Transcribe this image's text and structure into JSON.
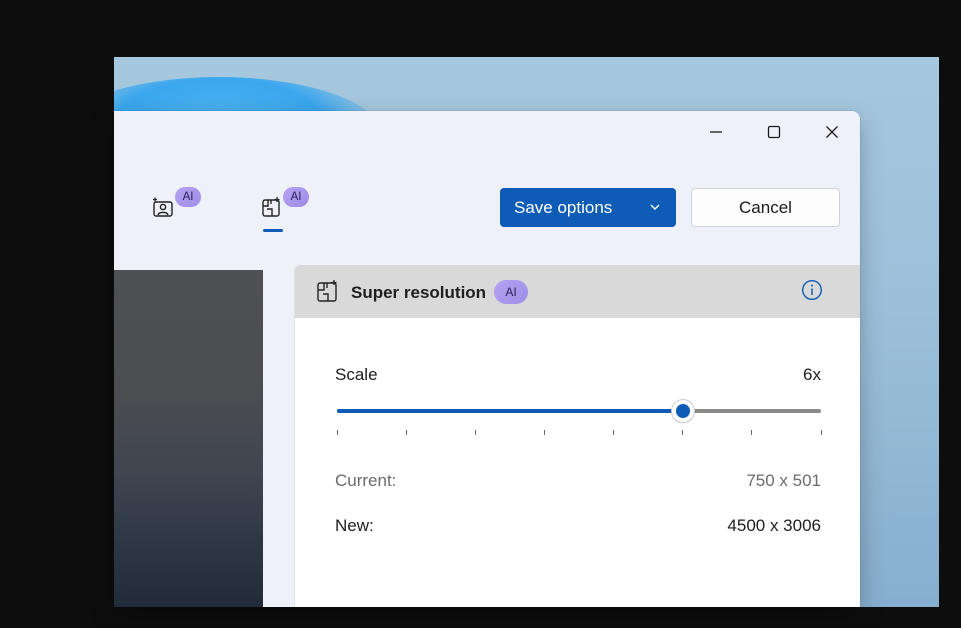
{
  "window": {
    "controls": {
      "minimize_icon": "minimize-icon",
      "maximize_icon": "maximize-icon",
      "close_icon": "close-icon"
    }
  },
  "toolbar": {
    "tools": [
      {
        "icon": "remove-background-icon",
        "badge": "AI",
        "selected": false
      },
      {
        "icon": "super-resolution-icon",
        "badge": "AI",
        "selected": true
      }
    ],
    "save_label": "Save options",
    "save_dropdown_icon": "chevron-down-icon",
    "cancel_label": "Cancel"
  },
  "panel": {
    "icon": "super-resolution-icon",
    "title": "Super resolution",
    "badge": "AI",
    "info_icon": "info-icon",
    "scale_label": "Scale",
    "scale_value": "6x",
    "slider": {
      "position": 0.714,
      "steps": 8
    },
    "current_label": "Current:",
    "current_value": "750 x 501",
    "new_label": "New:",
    "new_value": "4500 x 3006"
  },
  "colors": {
    "accent": "#0f5cb7",
    "ai_badge": "#a796ec",
    "panel_header": "#d9d9d9"
  }
}
